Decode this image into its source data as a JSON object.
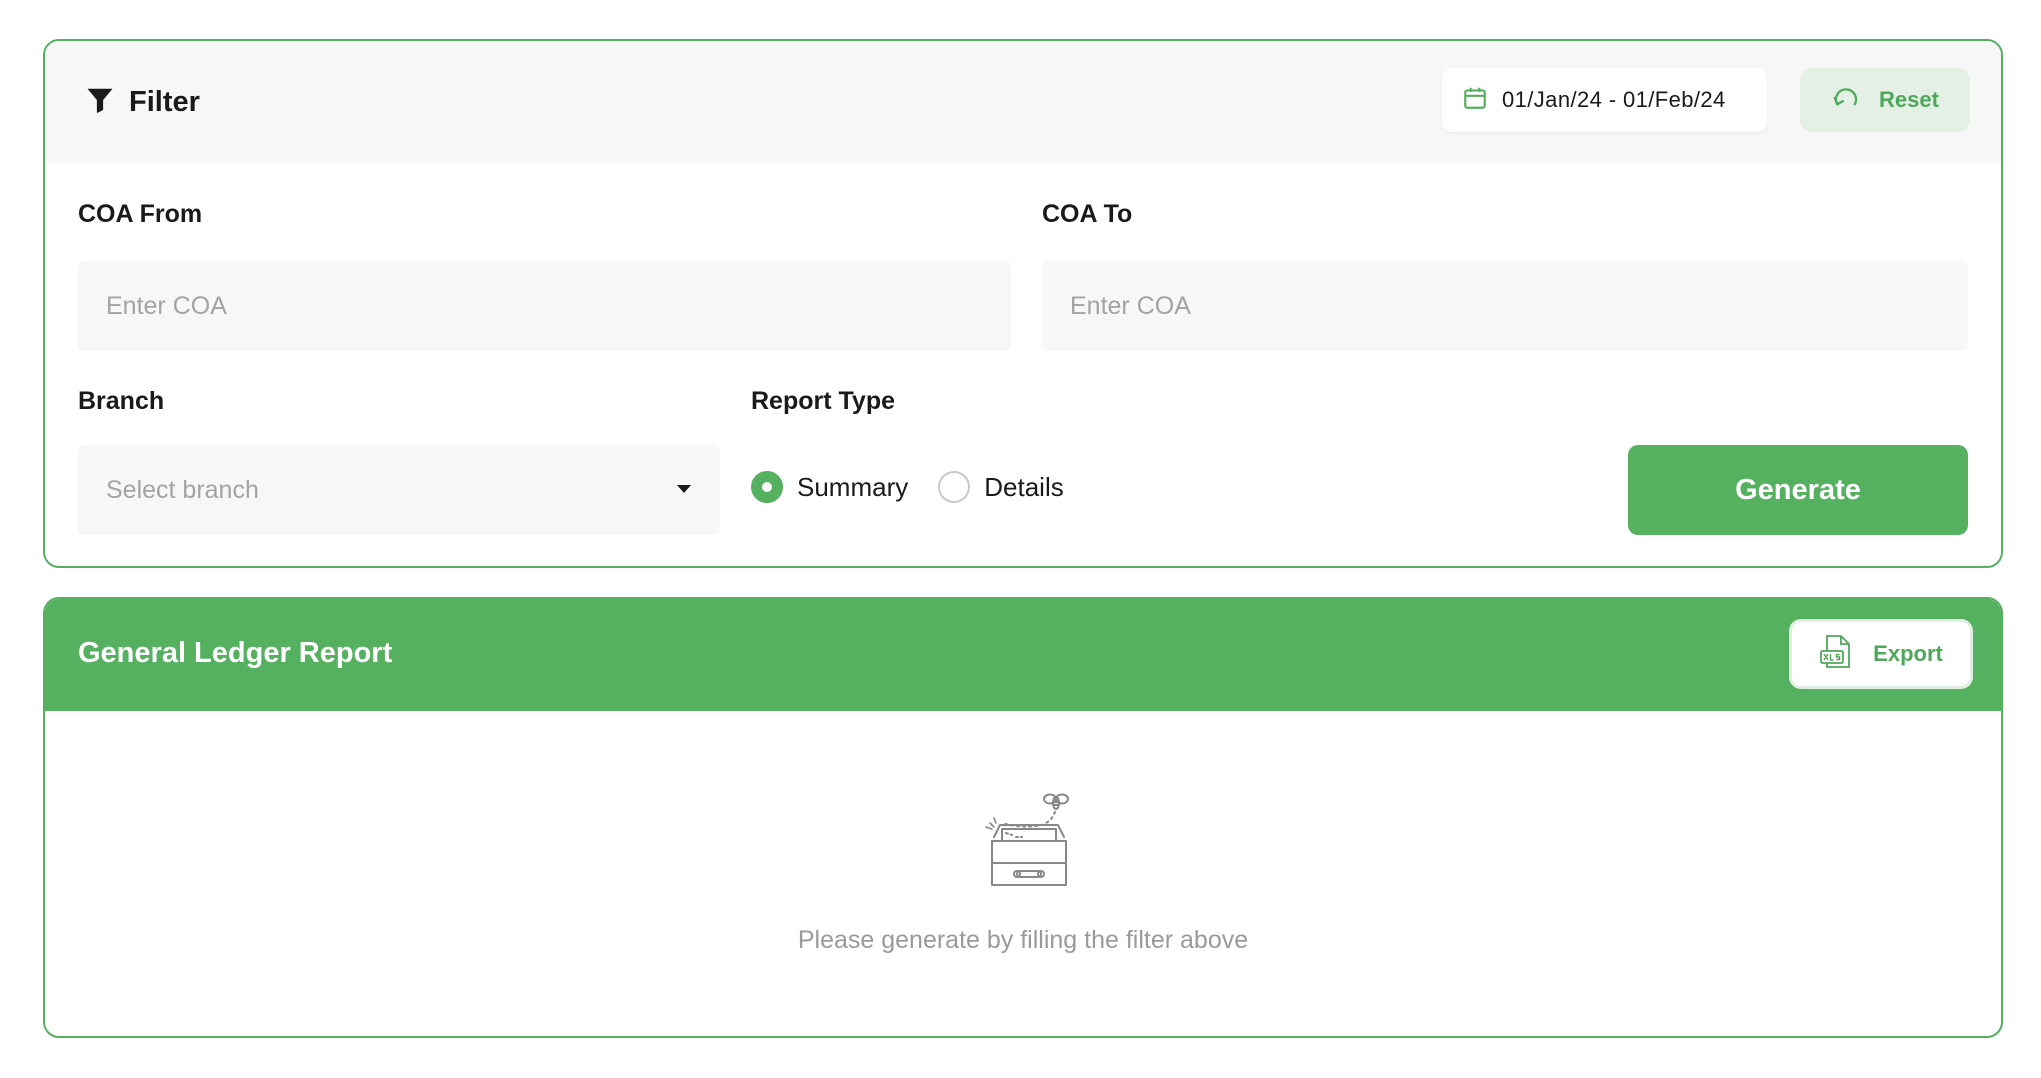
{
  "filter": {
    "title": "Filter",
    "date_range": "01/Jan/24 - 01/Feb/24",
    "reset_label": "Reset",
    "coa_from": {
      "label": "COA From",
      "placeholder": "Enter COA",
      "value": ""
    },
    "coa_to": {
      "label": "COA To",
      "placeholder": "Enter COA",
      "value": ""
    },
    "branch": {
      "label": "Branch",
      "placeholder": "Select branch"
    },
    "report_type": {
      "label": "Report Type",
      "options": [
        {
          "label": "Summary",
          "selected": true
        },
        {
          "label": "Details",
          "selected": false
        }
      ]
    },
    "generate_label": "Generate"
  },
  "report": {
    "title": "General Ledger Report",
    "export_label": "Export",
    "empty_message": "Please generate by filling the filter above"
  },
  "colors": {
    "accent": "#55b160",
    "accent_light": "#e4efe5",
    "input_bg": "#f7f7f7",
    "muted_text": "#a3a3a3"
  },
  "icons": [
    "filter-icon",
    "calendar-icon",
    "reset-icon",
    "chevron-down-icon",
    "xls-file-icon",
    "empty-box-icon"
  ]
}
